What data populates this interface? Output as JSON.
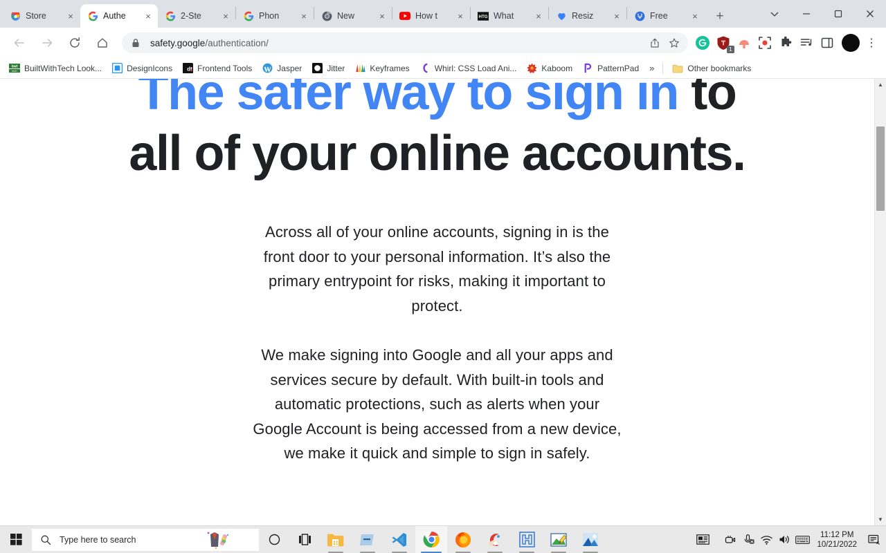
{
  "browser": {
    "tabs": [
      {
        "title": "Store",
        "favicon": "chrome-store-icon",
        "active": false
      },
      {
        "title": "Authe",
        "favicon": "google-icon",
        "active": true
      },
      {
        "title": "2-Ste",
        "favicon": "google-icon",
        "active": false
      },
      {
        "title": "Phon",
        "favicon": "google-icon",
        "active": false
      },
      {
        "title": "New",
        "favicon": "chromium-icon",
        "active": false
      },
      {
        "title": "How t",
        "favicon": "youtube-icon",
        "active": false
      },
      {
        "title": "What",
        "favicon": "howtogeek-icon",
        "active": false
      },
      {
        "title": "Resiz",
        "favicon": "blue-heart-icon",
        "active": false
      },
      {
        "title": "Free ",
        "favicon": "blue-circle-icon",
        "active": false
      }
    ],
    "new_tab_label": "+",
    "close_label": "×",
    "window_controls": {
      "tab_search_label": "∨",
      "minimize_label": "−",
      "maximize_label": "❐",
      "close_label": "×"
    },
    "toolbar": {
      "back_label": "←",
      "forward_label": "→",
      "reload_label": "⟳",
      "home_label": "⌂",
      "url_domain": "safety.google",
      "url_path": "/authentication/",
      "url_full": "safety.google/authentication/",
      "share_label": "share-icon",
      "bookmark_star_label": "☆",
      "extensions": [
        {
          "name": "grammarly-extension-icon",
          "badge": ""
        },
        {
          "name": "lastpass-extension-icon",
          "badge": "1"
        },
        {
          "name": "coral-extension-icon",
          "badge": ""
        },
        {
          "name": "screen-capture-extension-icon",
          "badge": ""
        },
        {
          "name": "puzzle-extensions-icon",
          "badge": ""
        },
        {
          "name": "media-playlist-icon",
          "badge": ""
        },
        {
          "name": "side-panel-icon",
          "badge": ""
        }
      ],
      "profile_label": "avatar",
      "menu_label": "⋮"
    },
    "bookmarks": [
      {
        "label": "BuiltWithTech Look...",
        "icon": "builtwithtech-icon"
      },
      {
        "label": "DesignIcons",
        "icon": "designicons-icon"
      },
      {
        "label": "Frontend Tools",
        "icon": "frontend-tools-icon"
      },
      {
        "label": "Jasper",
        "icon": "wordpress-icon"
      },
      {
        "label": "Jitter",
        "icon": "jitter-icon"
      },
      {
        "label": "Keyframes",
        "icon": "keyframes-icon"
      },
      {
        "label": "Whirl: CSS Load Ani...",
        "icon": "whirl-icon"
      },
      {
        "label": "Kaboom",
        "icon": "kaboom-icon"
      },
      {
        "label": "PatternPad",
        "icon": "patternpad-icon"
      }
    ],
    "bookmarks_overflow_label": "»",
    "other_bookmarks_label": "Other bookmarks",
    "other_bookmarks_icon": "folder-icon",
    "scrollbar": {
      "up_arrow": "▲",
      "down_arrow": "▼",
      "thumb_top_pct": 8,
      "thumb_height_pct": 19
    }
  },
  "page": {
    "heading": {
      "highlight": "The safer way to sign in",
      "rest": " to all of your online accounts.",
      "highlight_color": "#4285f4"
    },
    "paragraphs": [
      "Across all of your online accounts, signing in is the front door to your personal information. It’s also the primary entrypoint for risks, making it important to protect.",
      "We make signing into Google and all your apps and services secure by default. With built-in tools and automatic protections, such as alerts when your Google Account is being accessed from a new device, we make it quick and simple to sign in safely."
    ]
  },
  "taskbar": {
    "start_label": "start-icon",
    "search_placeholder": "Type here to search",
    "buttons": [
      {
        "name": "cortana-button",
        "label": "○"
      },
      {
        "name": "task-view-button",
        "label": "task-view-icon"
      }
    ],
    "apps": [
      {
        "name": "file-explorer",
        "active": false
      },
      {
        "name": "blue-app",
        "active": false
      },
      {
        "name": "visual-studio-code",
        "active": false
      },
      {
        "name": "google-chrome",
        "active": true
      },
      {
        "name": "mozilla-firefox",
        "active": false
      },
      {
        "name": "ccleaner",
        "active": false
      },
      {
        "name": "blue-logo-app",
        "active": false
      },
      {
        "name": "paint",
        "active": false
      },
      {
        "name": "photos",
        "active": false
      }
    ],
    "tray_icons": [
      "news-and-interests-icon",
      "camera-icon",
      "microphone-muted-icon",
      "wifi-icon",
      "volume-icon",
      "keyboard-icon"
    ],
    "clock_time": "11:12 PM",
    "clock_date": "10/21/2022",
    "notification_label": "notification-icon"
  }
}
